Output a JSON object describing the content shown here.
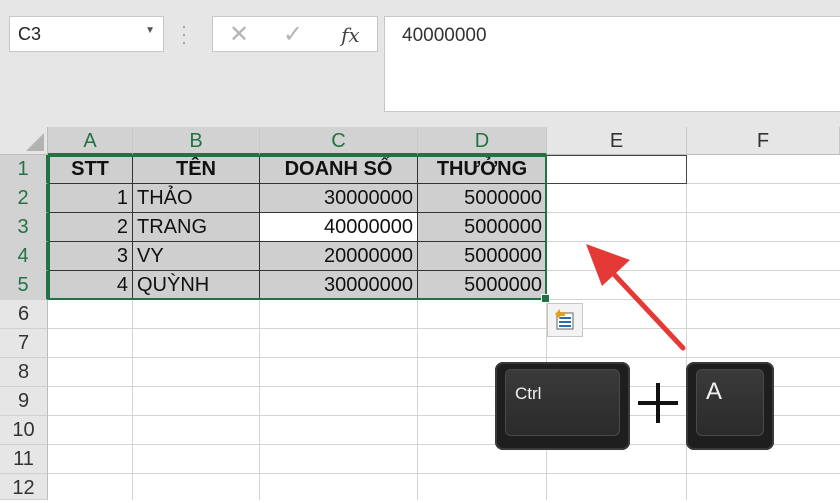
{
  "namebox": {
    "value": "C3"
  },
  "formula": {
    "value": "40000000"
  },
  "fx_label": "fx",
  "columns": [
    "A",
    "B",
    "C",
    "D",
    "E",
    "F"
  ],
  "rows": [
    "1",
    "2",
    "3",
    "4",
    "5",
    "6",
    "7",
    "8",
    "9",
    "10",
    "11",
    "12"
  ],
  "table": {
    "headers": [
      "STT",
      "TÊN",
      "DOANH SỐ",
      "THƯỞNG"
    ],
    "rows": [
      [
        "1",
        "THẢO",
        "30000000",
        "5000000"
      ],
      [
        "2",
        "TRANG",
        "40000000",
        "5000000"
      ],
      [
        "3",
        "VY",
        "20000000",
        "5000000"
      ],
      [
        "4",
        "QUỲNH",
        "30000000",
        "5000000"
      ]
    ]
  },
  "keys": {
    "ctrl": "Ctrl",
    "plus": "+",
    "a": "A"
  },
  "colors": {
    "selection": "#217346",
    "arrow": "#e53935"
  },
  "icons": [
    "dropdown-arrow-icon",
    "cancel-x-icon",
    "enter-check-icon",
    "function-fx-icon",
    "quick-analysis-icon",
    "red-arrow"
  ]
}
